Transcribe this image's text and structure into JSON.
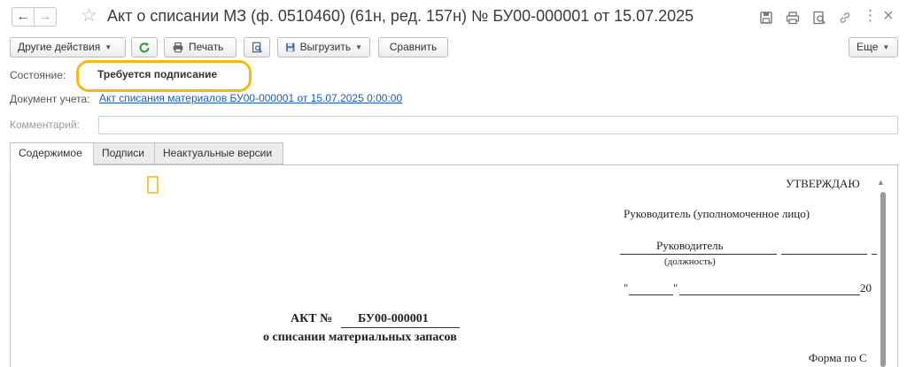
{
  "window": {
    "title": "Акт о списании МЗ (ф. 0510460) (61н, ред. 157н) № БУ00-000001 от 15.07.2025",
    "back_glyph": "←",
    "forward_glyph": "→",
    "icons": [
      "star-icon",
      "save-icon",
      "print-icon",
      "zoom-icon",
      "link-icon",
      "more-icon",
      "close-icon"
    ],
    "close_glyph": "×",
    "more_glyph": "⋮"
  },
  "toolbar": {
    "other_actions": "Другие действия",
    "print": "Печать",
    "export": "Выгрузить",
    "compare": "Сравнить",
    "more": "Еще"
  },
  "form": {
    "state_label": "Состояние:",
    "state_value": "Требуется подписание",
    "doc_label": "Документ учета:",
    "doc_link": "Акт списания материалов БУ00-000001 от 15.07.2025 0:00:00",
    "comment_label": "Комментарий:",
    "comment_value": ""
  },
  "tabs": [
    {
      "label": "Содержимое",
      "active": true
    },
    {
      "label": "Подписи",
      "active": false
    },
    {
      "label": "Неактуальные версии",
      "active": false
    }
  ],
  "printform": {
    "approve": "УТВЕРЖДАЮ",
    "head": "Руководитель (уполномоченное лицо)",
    "position_value": "Руководитель",
    "position_caption": "(должность)",
    "date_quote1": "\"",
    "date_quote2": "\"",
    "year_prefix": "20",
    "act_prefix": "АКТ №",
    "act_number": "БУ00-000001",
    "act_subtitle": "о списании материальных запасов",
    "form_caption": "Форма по С"
  },
  "colors": {
    "highlight": "#f5b914",
    "link": "#1f5ab4",
    "refresh_green": "#2e9e3a"
  }
}
